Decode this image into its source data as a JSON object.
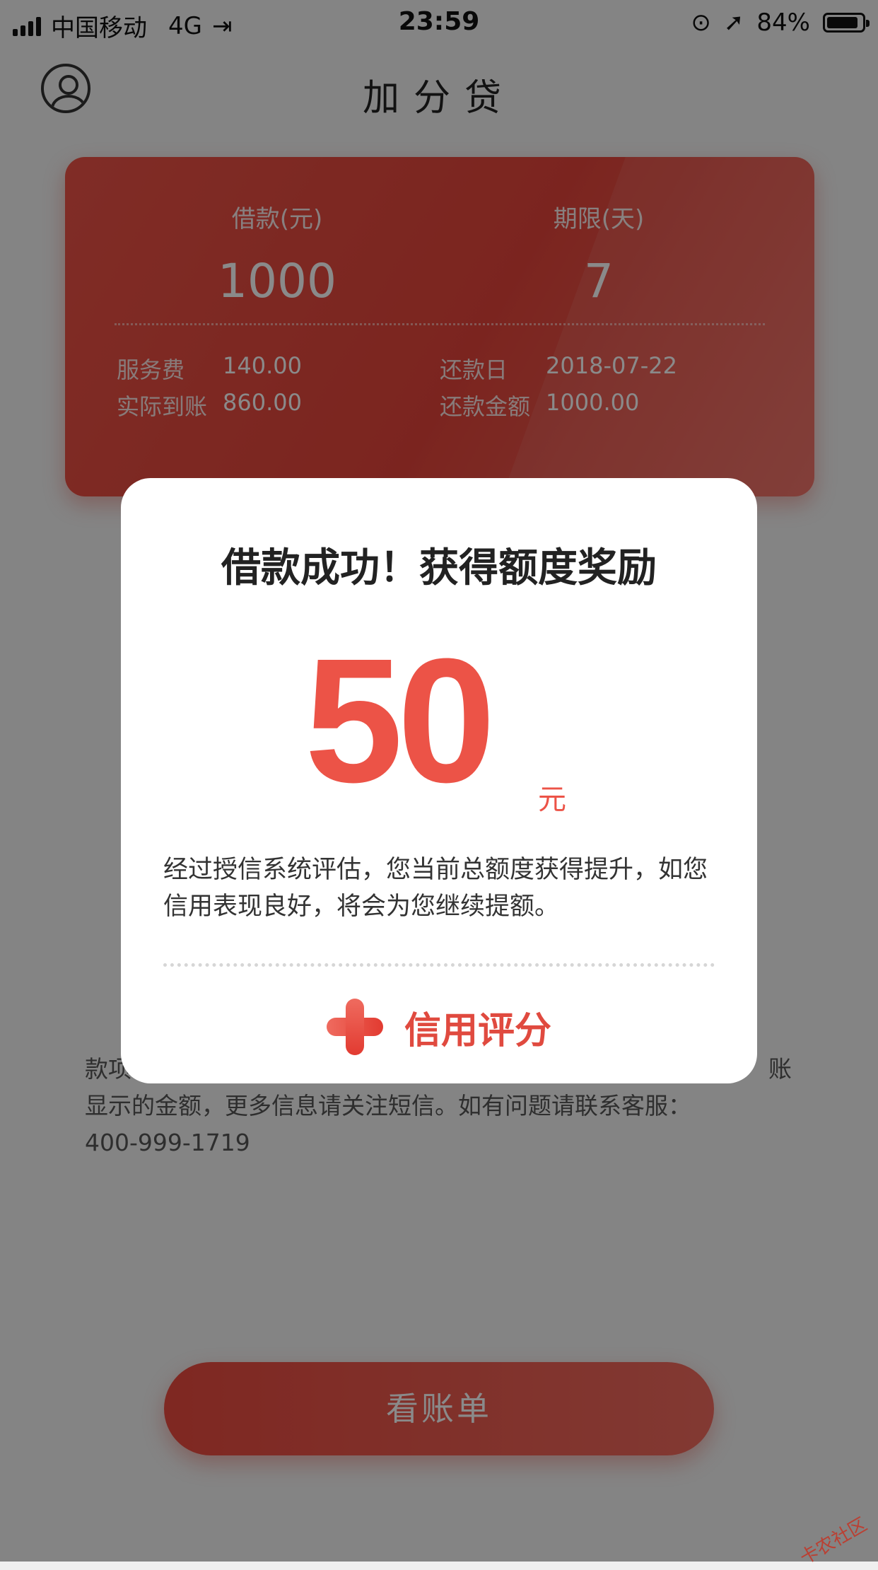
{
  "status_bar": {
    "carrier": "中国移动",
    "network": "4G",
    "time": "23:59",
    "battery_percent": "84%"
  },
  "header": {
    "title": "加分贷",
    "avatar_icon": "user-icon"
  },
  "loan_card": {
    "amount_label": "借款(元)",
    "amount_value": "1000",
    "term_label": "期限(天)",
    "term_value": "7",
    "details": [
      {
        "label": "服务费",
        "value": "140.00"
      },
      {
        "label": "实际到账",
        "value": "860.00"
      },
      {
        "label": "还款日",
        "value": "2018-07-22"
      },
      {
        "label": "还款金额",
        "value": "1000.00"
      }
    ]
  },
  "note": {
    "line1": "款项",
    "line1_tail": "账",
    "line2": "显示的金额，更多信息请关注短信。如有问题请联系客服：",
    "line3": "400-999-1719"
  },
  "bill_button": {
    "label": "看账单"
  },
  "modal": {
    "title": "借款成功！获得额度奖励",
    "amount": "50",
    "unit": "元",
    "description": "经过授信系统评估，您当前总额度获得提升，如您信用表现良好，将会为您继续提额。",
    "credit_icon": "plus-icon",
    "credit_label": "信用评分"
  },
  "watermark": "卡农社区",
  "colors": {
    "accent": "#ec5347",
    "overlay": "rgba(0,0,0,0.46)"
  }
}
